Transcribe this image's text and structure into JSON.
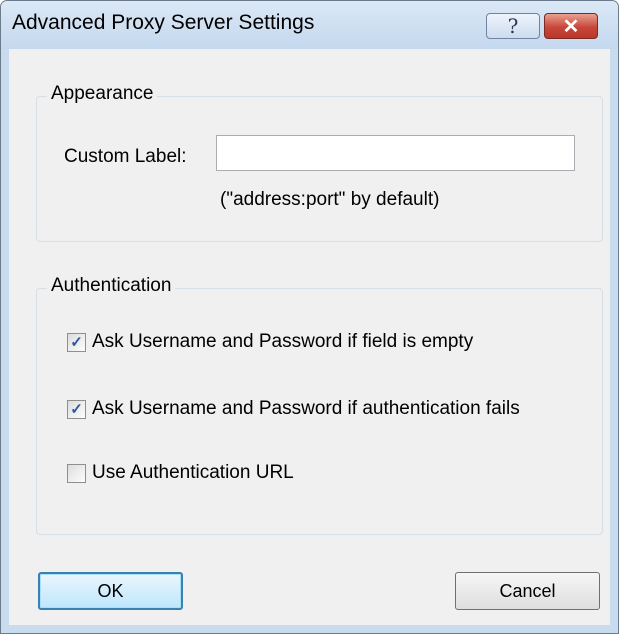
{
  "window": {
    "title": "Advanced Proxy Server Settings",
    "help_glyph": "?",
    "close_glyph": "✕"
  },
  "appearance": {
    "legend": "Appearance",
    "custom_label": "Custom Label:",
    "custom_label_value": "",
    "hint": "(\"address:port\" by default)"
  },
  "authentication": {
    "legend": "Authentication",
    "options": [
      {
        "label": "Ask Username and Password if field is empty",
        "checked": true,
        "mark": "✓"
      },
      {
        "label": "Ask Username and Password if authentication fails",
        "checked": true,
        "mark": "✓"
      },
      {
        "label": "Use Authentication URL",
        "checked": false,
        "mark": ""
      }
    ]
  },
  "buttons": {
    "ok": "OK",
    "cancel": "Cancel"
  }
}
